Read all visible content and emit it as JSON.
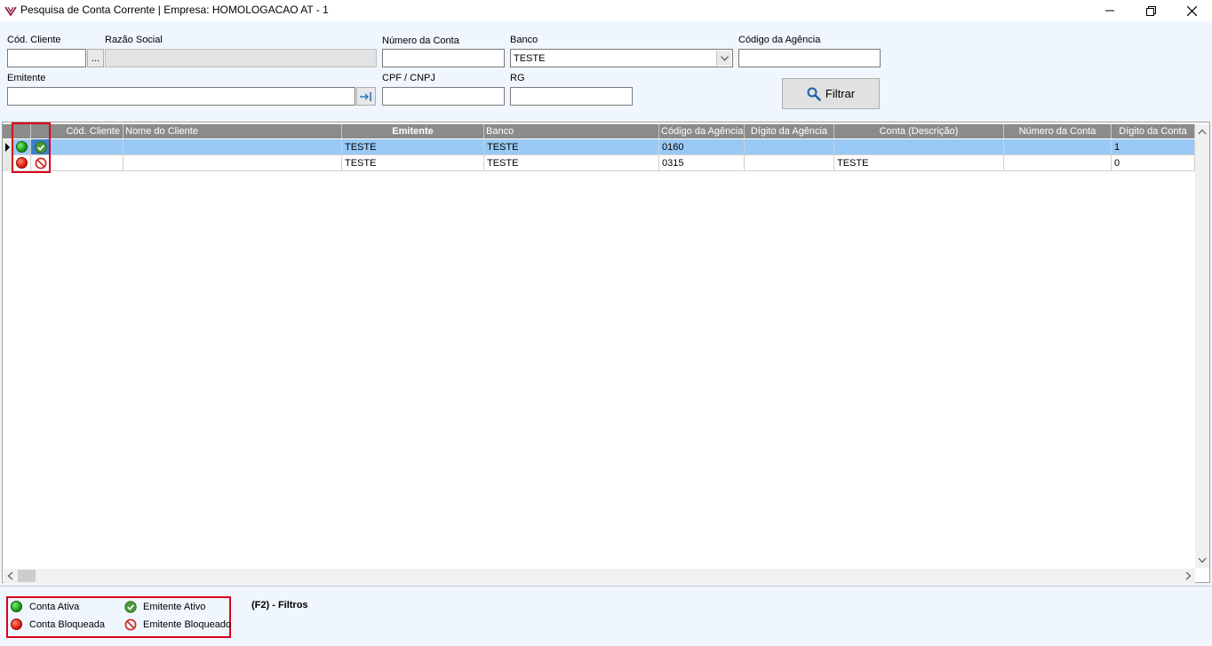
{
  "window": {
    "title": "Pesquisa de Conta Corrente | Empresa: HOMOLOGACAO AT - 1"
  },
  "filters": {
    "cod_cliente_label": "Cód. Cliente",
    "cod_cliente_value": "",
    "browse_label": "...",
    "razao_social_label": "Razão Social",
    "razao_social_value": "",
    "numero_conta_label": "Número da Conta",
    "numero_conta_value": "",
    "banco_label": "Banco",
    "banco_value": "TESTE",
    "codigo_agencia_label": "Código da Agência",
    "codigo_agencia_value": "",
    "emitente_label": "Emitente",
    "emitente_value": "",
    "cpf_cnpj_label": "CPF / CNPJ",
    "cpf_cnpj_value": "",
    "rg_label": "RG",
    "rg_value": "",
    "filtrar_label": "Filtrar"
  },
  "grid": {
    "columns": [
      "Cód. Cliente",
      "Nome do Cliente",
      "Emitente",
      "Banco",
      "Código da Agência",
      "Dígito da Agência",
      "Conta (Descrição)",
      "Número da Conta",
      "Dígito da Conta"
    ],
    "rows": [
      {
        "conta_status": "ativa",
        "emitente_status": "ativo",
        "cod_cliente": "",
        "nome_cliente": "",
        "emitente": "TESTE",
        "banco": "TESTE",
        "codigo_agencia": "0160",
        "digito_agencia": "",
        "conta_descricao": "",
        "numero_conta": "",
        "digito_conta": "1"
      },
      {
        "conta_status": "bloqueada",
        "emitente_status": "bloqueado",
        "cod_cliente": "",
        "nome_cliente": "",
        "emitente": "TESTE",
        "banco": "TESTE",
        "codigo_agencia": "0315",
        "digito_agencia": "",
        "conta_descricao": "TESTE",
        "numero_conta": "",
        "digito_conta": "0"
      }
    ]
  },
  "legend": {
    "conta_ativa": "Conta Ativa",
    "conta_bloqueada": "Conta Bloqueada",
    "emitente_ativo": "Emitente Ativo",
    "emitente_bloqueado": "Emitente Bloqueado",
    "shortcut": "(F2) - Filtros"
  },
  "colors": {
    "accent_red": "#d9001b",
    "status_green": "#1a9c1a",
    "status_red": "#e01b0b",
    "selection": "#99c9f5"
  }
}
